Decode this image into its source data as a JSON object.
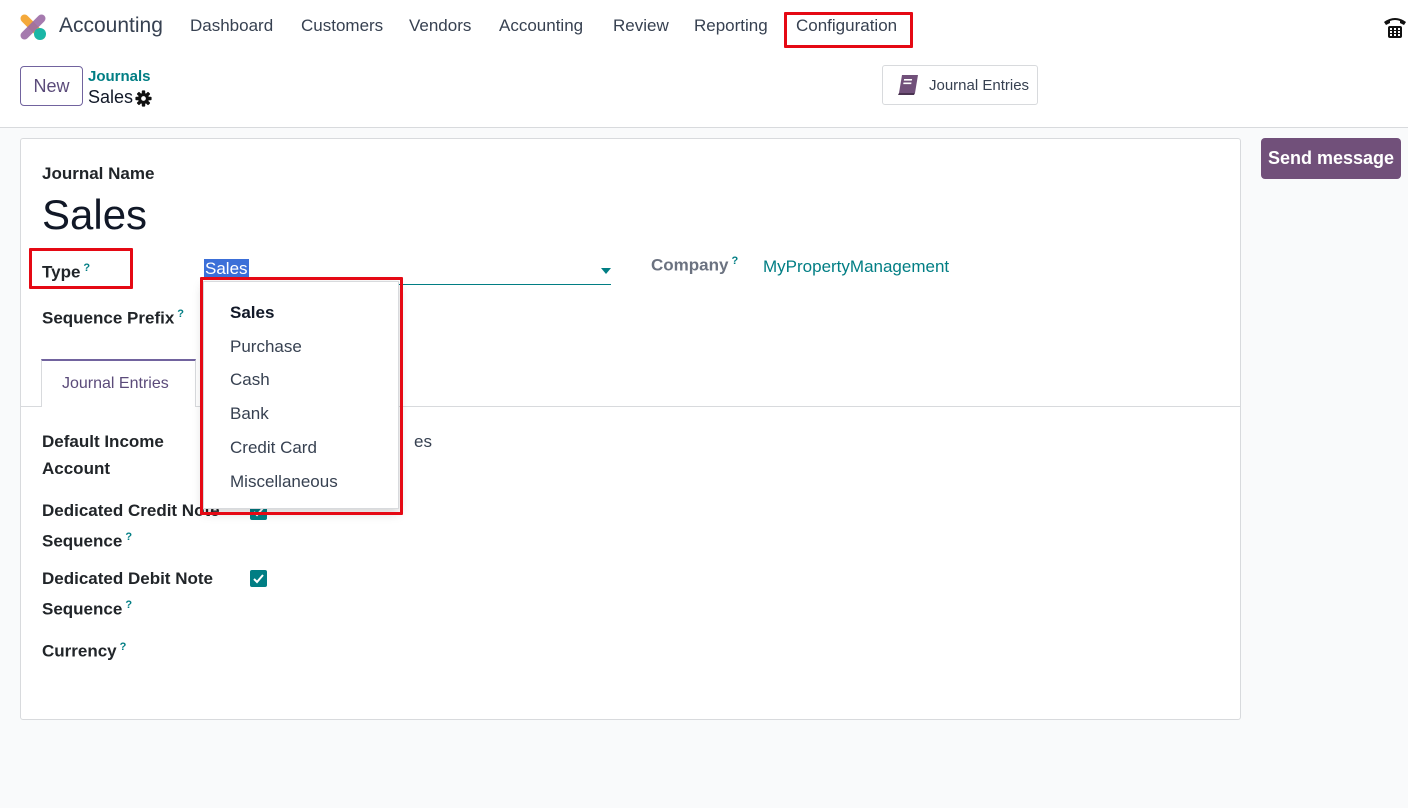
{
  "nav": {
    "app_title": "Accounting",
    "items": [
      "Dashboard",
      "Customers",
      "Vendors",
      "Accounting",
      "Review",
      "Reporting",
      "Configuration"
    ]
  },
  "control": {
    "new_label": "New",
    "breadcrumb_parent": "Journals",
    "breadcrumb_current": "Sales",
    "journal_entries_label": "Journal Entries"
  },
  "form": {
    "journal_name_label": "Journal Name",
    "journal_name": "Sales",
    "type_label": "Type",
    "type_value": "Sales",
    "help_mark": "?",
    "company_label": "Company",
    "company_value": "MyPropertyManagement",
    "sequence_prefix_label": "Sequence Prefix",
    "tab_label": "Journal Entries",
    "partial_text": "es",
    "default_income_account_label_1": "Default Income",
    "default_income_account_label_2": "Account",
    "credit_note_label_1": "Dedicated Credit Note",
    "credit_note_label_2": "Sequence",
    "credit_note_checked": true,
    "debit_note_label_1": "Dedicated Debit Note",
    "debit_note_label_2": "Sequence",
    "debit_note_checked": true,
    "currency_label": "Currency"
  },
  "dropdown": {
    "options": [
      "Sales",
      "Purchase",
      "Cash",
      "Bank",
      "Credit Card",
      "Miscellaneous"
    ],
    "selected": "Sales"
  },
  "chatter": {
    "send_message_label": "Send message"
  },
  "colors": {
    "brand_purple": "#71639e",
    "teal": "#017e84",
    "highlight_red": "#e50914"
  }
}
